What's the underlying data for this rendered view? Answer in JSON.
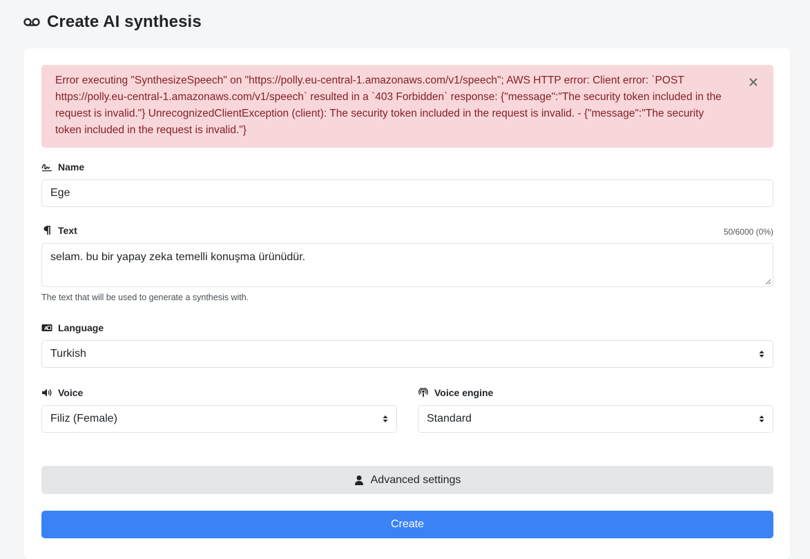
{
  "header": {
    "icon": "voicemail-icon",
    "title": "Create AI synthesis"
  },
  "alert": {
    "message": "Error executing \"SynthesizeSpeech\" on \"https://polly.eu-central-1.amazonaws.com/v1/speech\"; AWS HTTP error: Client error: `POST https://polly.eu-central-1.amazonaws.com/v1/speech` resulted in a `403 Forbidden` response: {\"message\":\"The security token included in the request is invalid.\"} UnrecognizedClientException (client): The security token included in the request is invalid. - {\"message\":\"The security token included in the request is invalid.\"}",
    "close_icon": "close-icon",
    "color_bg": "#f8d7da",
    "color_text": "#842029"
  },
  "form": {
    "name": {
      "label": "Name",
      "icon": "signature-icon",
      "value": "Ege"
    },
    "text": {
      "label": "Text",
      "icon": "paragraph-icon",
      "value": "selam. bu bir yapay zeka temelli konuşma ürünüdür.",
      "counter": "50/6000 (0%)",
      "hint": "The text that will be used to generate a synthesis with."
    },
    "language": {
      "label": "Language",
      "icon": "language-icon",
      "value": "Turkish"
    },
    "voice": {
      "label": "Voice",
      "icon": "volume-icon",
      "value": "Filiz (Female)"
    },
    "voice_engine": {
      "label": "Voice engine",
      "icon": "podcast-icon",
      "value": "Standard"
    }
  },
  "buttons": {
    "advanced": {
      "label": "Advanced settings",
      "icon": "user-icon"
    },
    "create": {
      "label": "Create",
      "color": "#3b82f6"
    }
  }
}
